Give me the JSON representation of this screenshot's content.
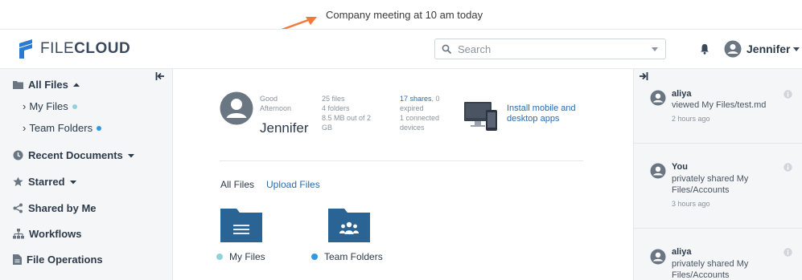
{
  "announcement": {
    "text": "Company meeting at 10 am today"
  },
  "header": {
    "logo_light": "FILE",
    "logo_bold": "CLOUD",
    "search_placeholder": "Search",
    "user_name": "Jennifer"
  },
  "sidebar": {
    "all_files": "All Files",
    "my_files": "My Files",
    "team_folders": "Team Folders",
    "recent_documents": "Recent Documents",
    "starred": "Starred",
    "shared_by_me": "Shared by Me",
    "workflows": "Workflows",
    "file_operations": "File Operations"
  },
  "summary": {
    "greeting_line1": "Good",
    "greeting_line2": "Afternoon",
    "name": "Jennifer",
    "files": "25 files",
    "folders": "4 folders",
    "storage_line1": "8.5 MB out of 2",
    "storage_line2": "GB",
    "shares_link": "17 shares",
    "shares_rest": ", 0",
    "expired": "expired",
    "connected_line1": "1 connected",
    "connected_line2": "devices",
    "install_line1": "Install mobile and",
    "install_line2": "desktop apps"
  },
  "tabs": {
    "all_files": "All Files",
    "upload_files": "Upload Files"
  },
  "folders": [
    {
      "label": "My Files",
      "dot_color": "#8fd3d9"
    },
    {
      "label": "Team Folders",
      "dot_color": "#2f9ae0"
    }
  ],
  "activity": [
    {
      "user": "aliya",
      "line1": "viewed My Files/test.md",
      "line2": "",
      "time": "2 hours ago"
    },
    {
      "user": "You",
      "line1": "privately shared My",
      "line2": "Files/Accounts",
      "time": "3 hours ago"
    },
    {
      "user": "aliya",
      "line1": "privately shared My",
      "line2": "Files/Accounts",
      "time": ""
    }
  ],
  "colors": {
    "brand": "#2b6cb0",
    "folder": "#2a6494",
    "icon": "#6b7683"
  }
}
